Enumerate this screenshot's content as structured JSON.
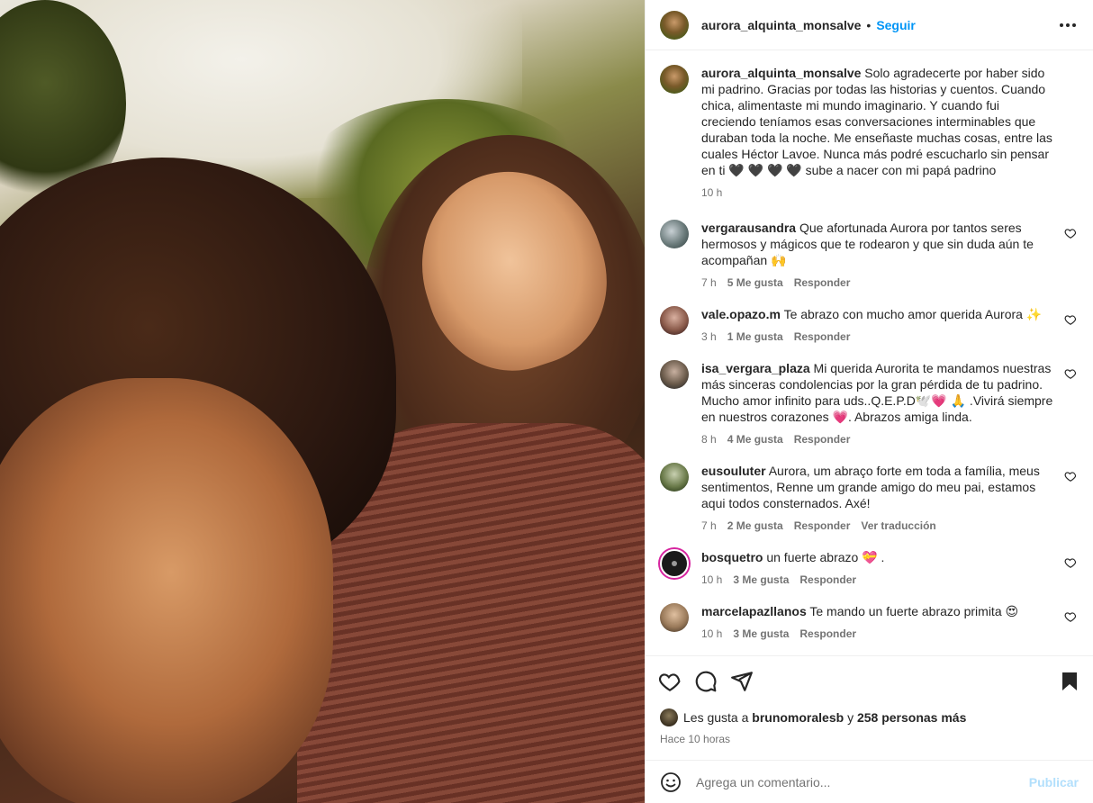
{
  "author": {
    "username": "aurora_alquinta_monsalve",
    "separator": "•",
    "follow_label": "Seguir"
  },
  "caption": {
    "username": "aurora_alquinta_monsalve",
    "text": "Solo agradecerte por haber sido mi padrino. Gracias por todas las historias y cuentos. Cuando chica, alimentaste mi mundo imaginario. Y cuando fui creciendo teníamos esas conversaciones interminables que duraban toda la noche. Me enseñaste muchas cosas, entre las cuales Héctor Lavoe. Nunca más podré escucharlo sin pensar en ti 🖤 🖤 🖤 🖤 sube a nacer con mi papá padrino",
    "time": "10 h"
  },
  "comments": [
    {
      "username": "vergarausandra",
      "text": "Que afortunada Aurora por tantos seres hermosos y mágicos que te rodearon y que sin duda aún te acompañan 🙌",
      "time": "7 h",
      "likes": "5 Me gusta",
      "reply": "Responder"
    },
    {
      "username": "vale.opazo.m",
      "text": "Te abrazo con mucho amor querida Aurora ✨",
      "time": "3 h",
      "likes": "1 Me gusta",
      "reply": "Responder"
    },
    {
      "username": "isa_vergara_plaza",
      "text": "Mi querida Aurorita te mandamos nuestras más sinceras condolencias por la gran pérdida de tu padrino. Mucho amor infinito para uds..Q.E.P.D🕊️💗 🙏 .Vivirá siempre en nuestros corazones 💗. Abrazos amiga linda.",
      "time": "8 h",
      "likes": "4 Me gusta",
      "reply": "Responder"
    },
    {
      "username": "eusouluter",
      "text": "Aurora, um abraço forte em toda a família, meus sentimentos, Renne um grande amigo do meu pai, estamos aqui todos consternados. Axé!",
      "time": "7 h",
      "likes": "2 Me gusta",
      "reply": "Responder",
      "translate": "Ver traducción"
    },
    {
      "username": "bosquetro",
      "text": "un fuerte abrazo 💝 .",
      "time": "10 h",
      "likes": "3 Me gusta",
      "reply": "Responder"
    },
    {
      "username": "marcelapazllanos",
      "text": "Te mando un fuerte abrazo primita 😍",
      "time": "10 h",
      "likes": "3 Me gusta",
      "reply": "Responder"
    }
  ],
  "likes_line": {
    "prefix": "Les gusta a",
    "user": "brunomoralesb",
    "connector": "y",
    "others": "258 personas más"
  },
  "posted_time": "Hace 10 horas",
  "comment_box": {
    "placeholder": "Agrega un comentario...",
    "post_label": "Publicar"
  },
  "icons": {
    "like": "heart-icon",
    "comment": "comment-icon",
    "share": "share-icon",
    "save": "bookmark-icon",
    "emoji": "emoji-icon",
    "more": "more-icon"
  },
  "colors": {
    "accent": "#0095f6",
    "text": "#262626",
    "muted": "#737373",
    "post_disabled": "#b2dffc"
  }
}
